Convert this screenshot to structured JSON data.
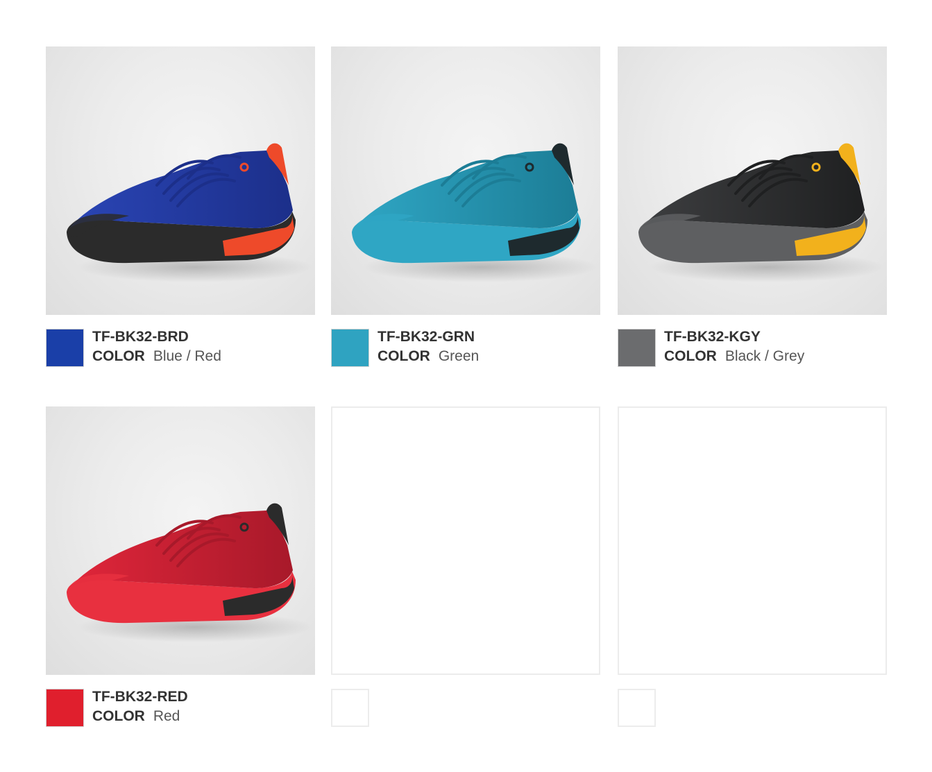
{
  "products": [
    {
      "code": "TF-BK32-BRD",
      "color_label": "COLOR",
      "color_value": "Blue / Red",
      "swatch_color": "#1a3fa8",
      "upper_color": "#2a45b5",
      "upper_shade": "#1c2f8a",
      "sole_color": "#2b2b2b",
      "accent_color": "#ee4a2a",
      "image": "shoe-blue-red"
    },
    {
      "code": "TF-BK32-GRN",
      "color_label": "COLOR",
      "color_value": "Green",
      "swatch_color": "#2fa3c1",
      "upper_color": "#2fa6c4",
      "upper_shade": "#1c7d96",
      "sole_color": "#2fa6c4",
      "accent_color": "#1e2a2e",
      "image": "shoe-green"
    },
    {
      "code": "TF-BK32-KGY",
      "color_label": "COLOR",
      "color_value": "Black / Grey",
      "swatch_color": "#6b6c6e",
      "upper_color": "#3d3e40",
      "upper_shade": "#1f2021",
      "sole_color": "#5e5f61",
      "accent_color": "#f2b11c",
      "image": "shoe-black-grey"
    },
    {
      "code": "TF-BK32-RED",
      "color_label": "COLOR",
      "color_value": "Red",
      "swatch_color": "#e01f2d",
      "upper_color": "#e0263a",
      "upper_shade": "#a8192a",
      "sole_color": "#e8303f",
      "accent_color": "#2b2b2b",
      "image": "shoe-red"
    }
  ]
}
